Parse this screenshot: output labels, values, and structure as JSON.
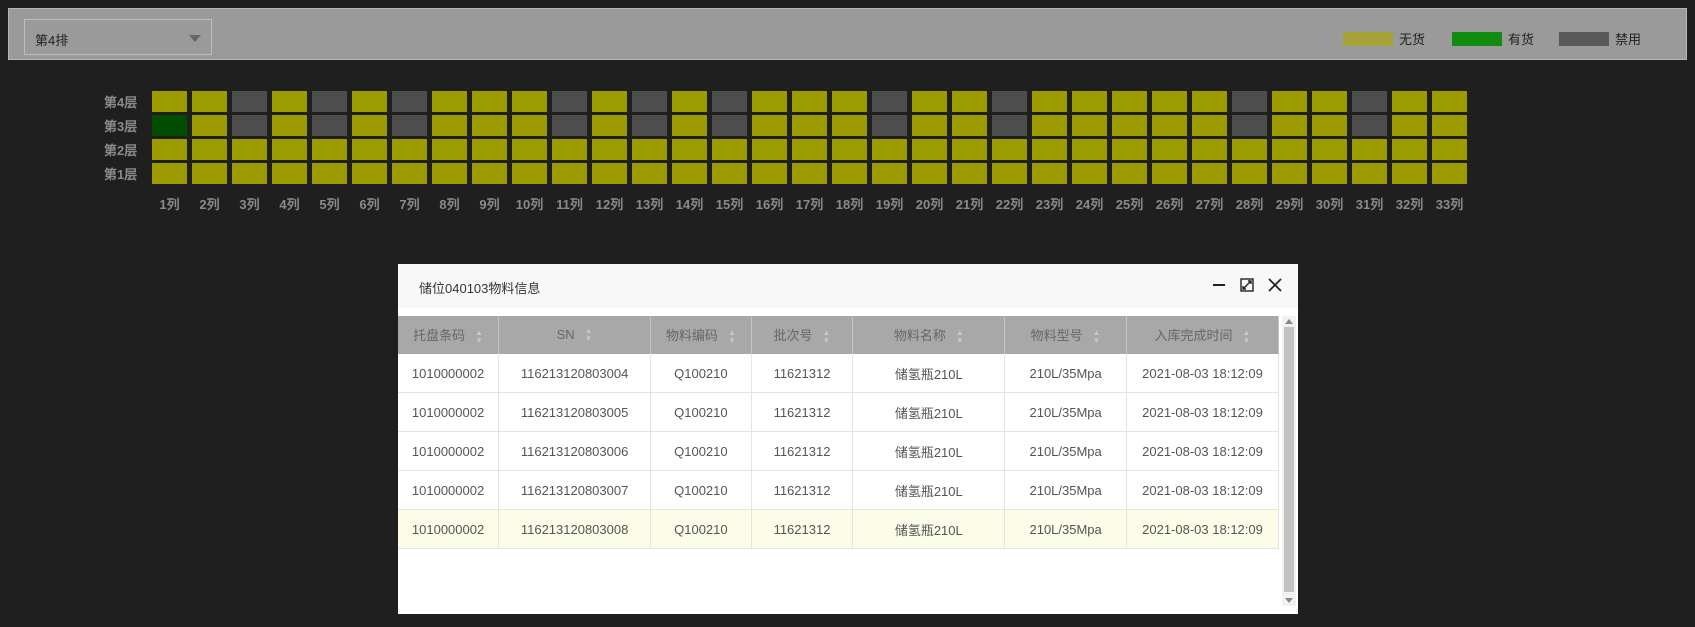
{
  "row_select": {
    "value": "第4排"
  },
  "legend": [
    {
      "label": "无货",
      "color": "#a3a33a"
    },
    {
      "label": "有货",
      "color": "#118c11"
    },
    {
      "label": "禁用",
      "color": "#595959"
    }
  ],
  "colors": {
    "empty": "#9b9b00",
    "stocked": "#004d00",
    "disabled": "#4d4d4d"
  },
  "layers": [
    "第4层",
    "第3层",
    "第2层",
    "第1层"
  ],
  "columns": [
    "1列",
    "2列",
    "3列",
    "4列",
    "5列",
    "6列",
    "7列",
    "8列",
    "9列",
    "10列",
    "11列",
    "12列",
    "13列",
    "14列",
    "15列",
    "16列",
    "17列",
    "18列",
    "19列",
    "20列",
    "21列",
    "22列",
    "23列",
    "24列",
    "25列",
    "26列",
    "27列",
    "28列",
    "29列",
    "30列",
    "31列",
    "32列",
    "33列"
  ],
  "grid_status": [
    "eedededeeedededeeedeedeeeeedeedee",
    "sedededeeedededeeedeedeeeeedeedee",
    "eeeeeeeeeeeeeeeeeeeeeeeeeeeeeeeee",
    "eeeeeeeeeeeeeeeeeeeeeeeeeeeeeeeee"
  ],
  "dialog": {
    "title": "储位040103物料信息",
    "headers": [
      "托盘条码",
      "SN",
      "物料编码",
      "批次号",
      "物料名称",
      "物料型号",
      "入库完成时间"
    ],
    "rows": [
      [
        "1010000002",
        "116213120803004",
        "Q100210",
        "11621312",
        "储氢瓶210L",
        "210L/35Mpa",
        "2021-08-03 18:12:09"
      ],
      [
        "1010000002",
        "116213120803005",
        "Q100210",
        "11621312",
        "储氢瓶210L",
        "210L/35Mpa",
        "2021-08-03 18:12:09"
      ],
      [
        "1010000002",
        "116213120803006",
        "Q100210",
        "11621312",
        "储氢瓶210L",
        "210L/35Mpa",
        "2021-08-03 18:12:09"
      ],
      [
        "1010000002",
        "116213120803007",
        "Q100210",
        "11621312",
        "储氢瓶210L",
        "210L/35Mpa",
        "2021-08-03 18:12:09"
      ],
      [
        "1010000002",
        "116213120803008",
        "Q100210",
        "11621312",
        "储氢瓶210L",
        "210L/35Mpa",
        "2021-08-03 18:12:09"
      ]
    ],
    "highlighted_row": 4
  }
}
